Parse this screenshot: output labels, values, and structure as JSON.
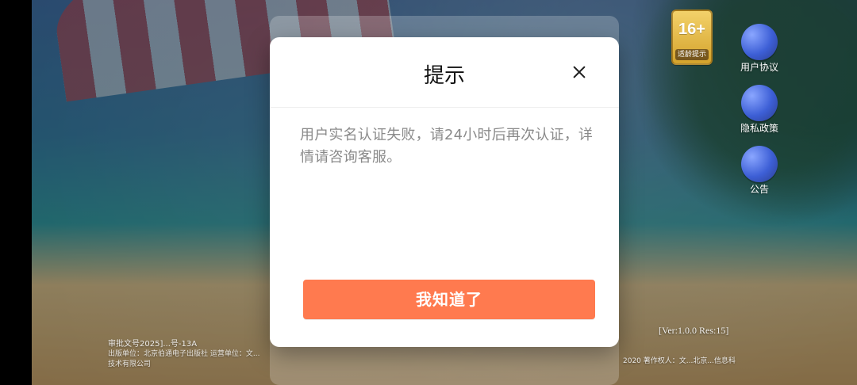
{
  "badge": {
    "age_rating": "16+",
    "age_text": "适龄提示"
  },
  "side_menu": {
    "items": [
      {
        "label": "用户协议",
        "icon": "document-icon"
      },
      {
        "label": "隐私政策",
        "icon": "document-icon"
      },
      {
        "label": "公告",
        "icon": "megaphone-icon"
      }
    ]
  },
  "dialog": {
    "title": "提示",
    "message": "用户实名认证失败，请24小时后再次认证，详情请咨询客服。",
    "button_label": "我知道了",
    "close_icon": "close-icon",
    "colors": {
      "button": "#ff7a4f",
      "title": "#111111",
      "message": "#8a8a8a"
    }
  },
  "footer": {
    "left_line1": "审批文号2025]...号-13A",
    "left_line2": "出版单位：北京伯通电子出版社  运营单位：文...",
    "left_line3": "技术有限公司",
    "right_line": "2020  著作权人：文...北京...信息科",
    "version": "[Ver:1.0.0  Res:15]"
  }
}
